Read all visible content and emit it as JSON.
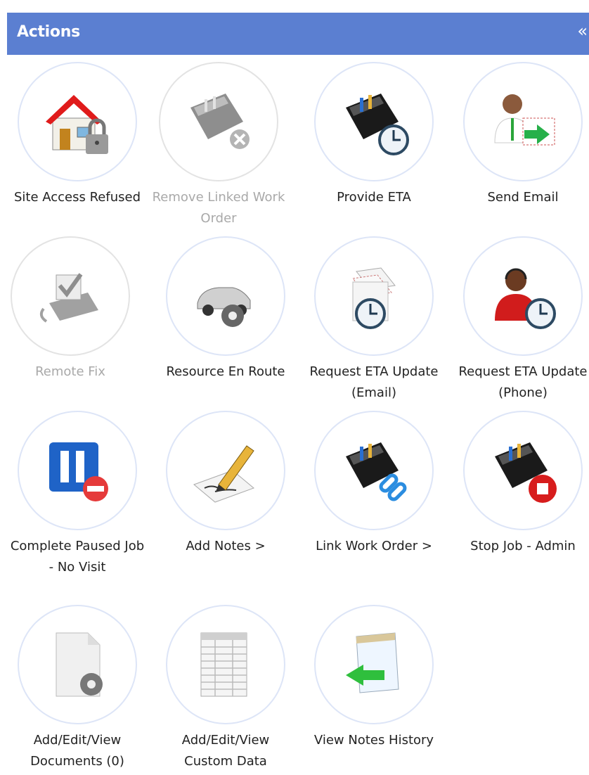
{
  "header": {
    "title": "Actions",
    "collapse_glyph": "«"
  },
  "actions": [
    {
      "label": "Site Access Refused",
      "icon": "house-lock-icon",
      "enabled": true
    },
    {
      "label": "Remove Linked Work Order",
      "icon": "toolbox-unlink-icon",
      "enabled": false
    },
    {
      "label": "Provide ETA",
      "icon": "toolbox-clock-icon",
      "enabled": true
    },
    {
      "label": "Send Email",
      "icon": "person-email-icon",
      "enabled": true
    },
    {
      "label": "Remote Fix",
      "icon": "phone-check-icon",
      "enabled": false
    },
    {
      "label": "Resource En Route",
      "icon": "car-gear-icon",
      "enabled": true
    },
    {
      "label": "Request ETA Update (Email)",
      "icon": "envelope-clock-icon",
      "enabled": true
    },
    {
      "label": "Request ETA Update (Phone)",
      "icon": "operator-clock-icon",
      "enabled": true
    },
    {
      "label": "Complete Paused Job - No Visit",
      "icon": "pause-stop-icon",
      "enabled": true
    },
    {
      "label": "Add Notes >",
      "icon": "pencil-note-icon",
      "enabled": true
    },
    {
      "label": "Link Work Order >",
      "icon": "toolbox-link-icon",
      "enabled": true
    },
    {
      "label": "Stop Job - Admin",
      "icon": "toolbox-stop-icon",
      "enabled": true
    },
    {
      "label": "Add/Edit/View Documents (0)",
      "icon": "document-gear-icon",
      "enabled": true
    },
    {
      "label": "Add/Edit/View Custom Data",
      "icon": "spreadsheet-icon",
      "enabled": true
    },
    {
      "label": "View Notes History",
      "icon": "notepad-arrow-icon",
      "enabled": true
    }
  ]
}
